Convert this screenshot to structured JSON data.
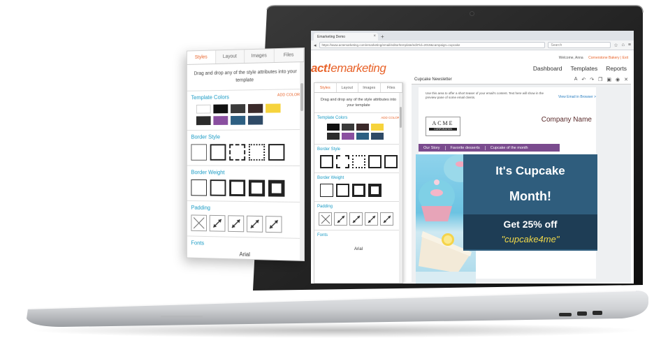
{
  "browser": {
    "tab_title": "Emarketing Demo",
    "new_tab": "+",
    "url": "https://www.actemarketing.com/emarketing/email/editor/template/edit?id=2019&campaign=cupcake",
    "search_placeholder": "Search"
  },
  "app": {
    "logo_bold": "act!",
    "logo_rest": "emarketing",
    "welcome": "Welcome, Anna",
    "org_link": "Cornerstone Bakery | Exit",
    "nav": [
      "Dashboard",
      "Templates",
      "Reports"
    ]
  },
  "style_panel": {
    "tabs": [
      "Styles",
      "Layout",
      "Images",
      "Files"
    ],
    "description": "Drag and drop any of the style attributes into your template",
    "template_colors_title": "Template Colors",
    "add_color": "ADD COLOR",
    "colors": [
      "#ffffff",
      "#111111",
      "#3a3a3a",
      "#3b2a2a",
      "#f6d33c",
      "#2b2b2b",
      "#8a4fa0",
      "#2d5f82",
      "#2f4a66"
    ],
    "border_style_title": "Border Style",
    "border_weight_title": "Border Weight",
    "padding_title": "Padding",
    "fonts_title": "Fonts",
    "font_value": "Arial"
  },
  "editor": {
    "title": "Cupcake Newsletter",
    "teaser": "Use this area to offer a short teaser of your email's content. Text here will show in the preview pane of some email clients.",
    "view_in_browser": "View Email in Browser >",
    "acme_big": "ACME",
    "acme_small": "CORPORATION",
    "company_name": "Company Name",
    "nav_items": [
      "Our Story",
      "Favorite desserts",
      "Cupcake of the month"
    ],
    "banner_line1": "It's Cupcake",
    "banner_line2": "Month!",
    "banner_offer": "Get 25% off",
    "banner_code": "\"cupcake4me\""
  },
  "colors": {
    "accent": "#e8632a",
    "section_title": "#1a9bc5",
    "purple_nav": "#7a4b8e",
    "banner": "#2f5d7d"
  }
}
